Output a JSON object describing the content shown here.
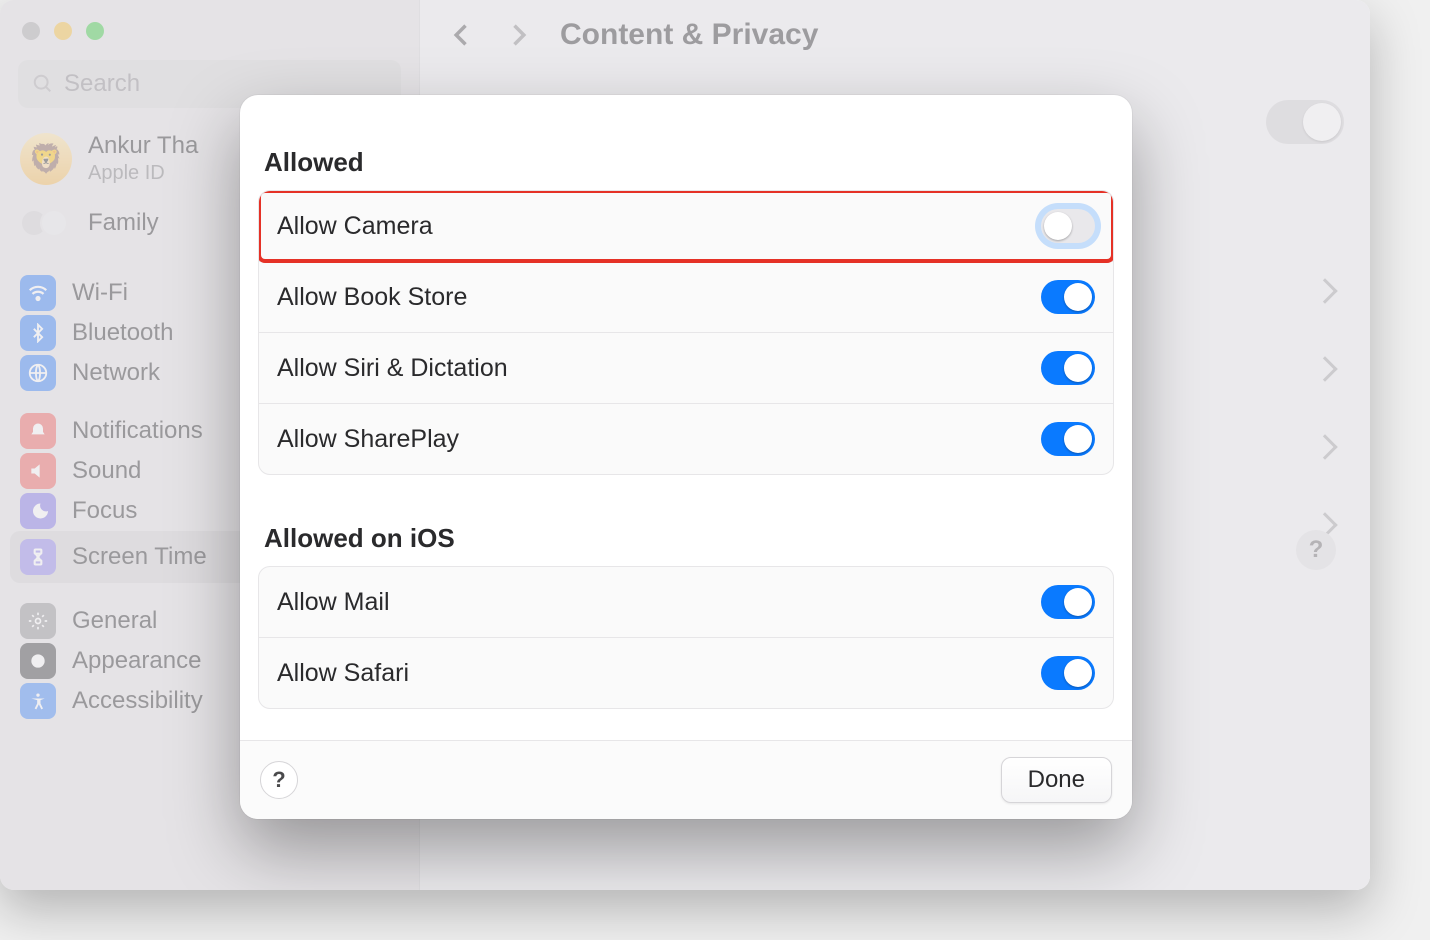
{
  "window": {
    "title": "Content & Privacy"
  },
  "search": {
    "placeholder": "Search"
  },
  "account": {
    "name": "Ankur Tha",
    "sub": "Apple ID"
  },
  "sidebar": {
    "family": "Family",
    "items": [
      {
        "label": "Wi-Fi"
      },
      {
        "label": "Bluetooth"
      },
      {
        "label": "Network"
      },
      {
        "label": "Notifications"
      },
      {
        "label": "Sound"
      },
      {
        "label": "Focus"
      },
      {
        "label": "Screen Time"
      },
      {
        "label": "General"
      },
      {
        "label": "Appearance"
      },
      {
        "label": "Accessibility"
      }
    ]
  },
  "modal": {
    "section1": "Allowed",
    "section2": "Allowed on iOS",
    "rows1": [
      {
        "label": "Allow Camera",
        "on": false
      },
      {
        "label": "Allow Book Store",
        "on": true
      },
      {
        "label": "Allow Siri & Dictation",
        "on": true
      },
      {
        "label": "Allow SharePlay",
        "on": true
      }
    ],
    "rows2": [
      {
        "label": "Allow Mail",
        "on": true
      },
      {
        "label": "Allow Safari",
        "on": true
      }
    ],
    "help": "?",
    "done": "Done"
  },
  "help_main": "?"
}
